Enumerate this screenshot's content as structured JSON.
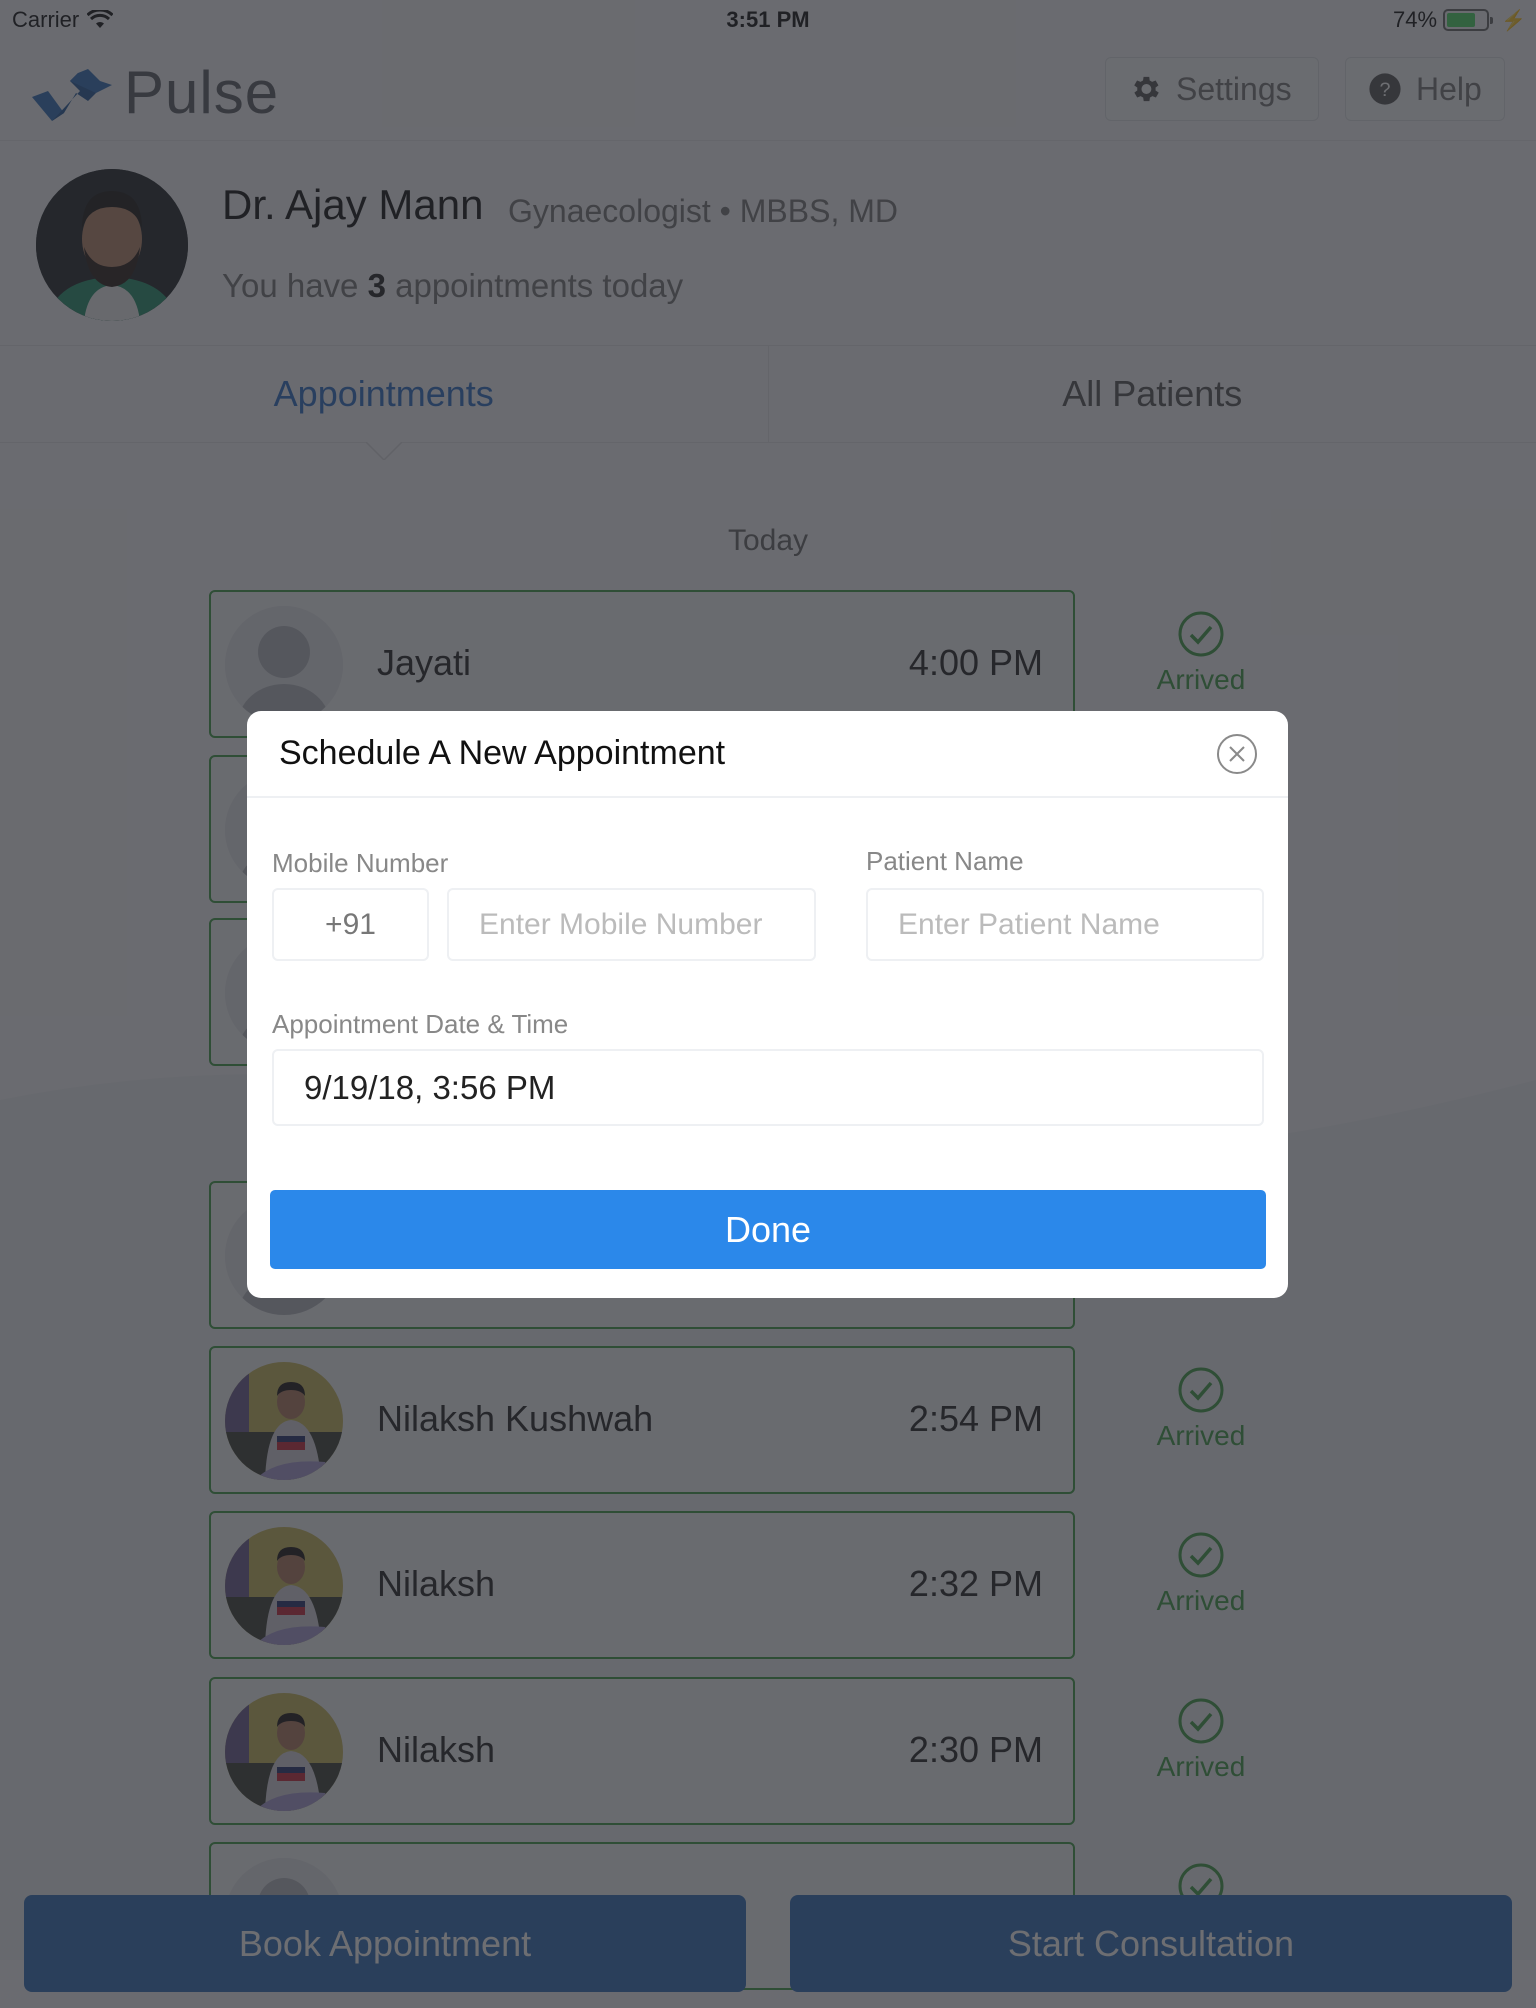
{
  "status_bar": {
    "carrier": "Carrier",
    "time": "3:51 PM",
    "battery_percent_label": "74%",
    "battery_level": 0.74
  },
  "header": {
    "app_name": "Pulse",
    "settings_label": "Settings",
    "help_label": "Help"
  },
  "doctor": {
    "name": "Dr. Ajay Mann",
    "specialty": "Gynaecologist • MBBS, MD",
    "count_prefix": "You have ",
    "count_value": "3",
    "count_suffix": " appointments today"
  },
  "tabs": [
    {
      "label": "Appointments",
      "active": true
    },
    {
      "label": "All Patients",
      "active": false
    }
  ],
  "section_label": "Today",
  "appointments": [
    {
      "name": "Jayati",
      "time": "4:00 PM",
      "status": "Arrived",
      "avatar": "placeholder"
    },
    {
      "name": "",
      "time": "",
      "status": "",
      "avatar": "placeholder"
    },
    {
      "name": "",
      "time": "",
      "status": "",
      "avatar": "placeholder"
    },
    {
      "name": "",
      "time": "",
      "status": "",
      "avatar": "placeholder"
    },
    {
      "name": "Nilaksh Kushwah",
      "time": "2:54 PM",
      "status": "Arrived",
      "avatar": "photo"
    },
    {
      "name": "Nilaksh",
      "time": "2:32 PM",
      "status": "Arrived",
      "avatar": "photo"
    },
    {
      "name": "Nilaksh",
      "time": "2:30 PM",
      "status": "Arrived",
      "avatar": "photo"
    },
    {
      "name": "",
      "time": "",
      "status": "",
      "avatar": "placeholder"
    }
  ],
  "footer": {
    "book_label": "Book Appointment",
    "consult_label": "Start Consultation"
  },
  "modal": {
    "title": "Schedule A New Appointment",
    "mobile_label": "Mobile Number",
    "country_code": "+91",
    "mobile_placeholder": "Enter Mobile Number",
    "patient_label": "Patient Name",
    "patient_placeholder": "Enter Patient Name",
    "datetime_label": "Appointment Date & Time",
    "datetime_value": "9/19/18, 3:56 PM",
    "done_label": "Done"
  },
  "colors": {
    "accent_blue": "#2b88ea",
    "tab_active": "#2d6fc3",
    "arrived_green": "#3f9b46",
    "footer_button": "#2f6eb7"
  }
}
